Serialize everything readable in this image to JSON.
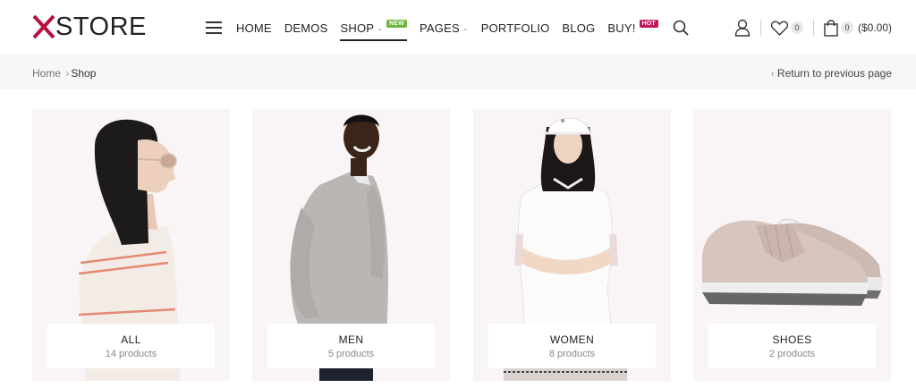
{
  "brand": {
    "logo_text": "STORE",
    "logo_mark": "X",
    "accent": "#b5123f"
  },
  "nav": {
    "items": [
      {
        "label": "HOME"
      },
      {
        "label": "DEMOS"
      },
      {
        "label": "SHOP",
        "badge": "NEW"
      },
      {
        "label": "PAGES"
      },
      {
        "label": "PORTFOLIO"
      },
      {
        "label": "BLOG"
      },
      {
        "label": "BUY!",
        "badge": "HOT"
      }
    ],
    "active": "SHOP"
  },
  "tools": {
    "wishlist_count": "0",
    "cart_count": "0",
    "cart_total": "($0.00)"
  },
  "breadcrumb": {
    "home": "Home",
    "current": "Shop",
    "return_label": "Return to previous page"
  },
  "categories": [
    {
      "title": "ALL",
      "count": "14 products"
    },
    {
      "title": "MEN",
      "count": "5 products"
    },
    {
      "title": "WOMEN",
      "count": "8 products"
    },
    {
      "title": "SHOES",
      "count": "2 products"
    }
  ]
}
